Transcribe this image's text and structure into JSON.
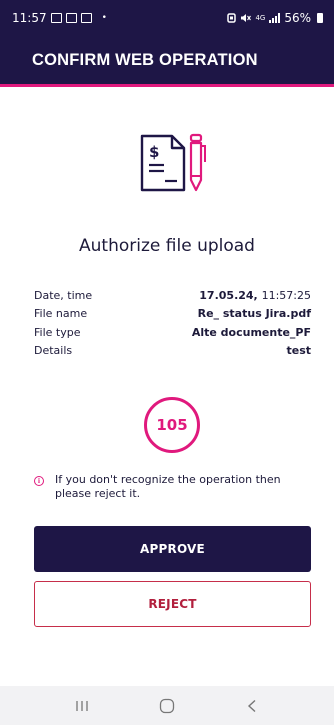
{
  "status_bar": {
    "time": "11:57",
    "dot": "•",
    "network_label": "4G",
    "battery_percent": "56%",
    "icons": [
      "gallery-icon",
      "gallery-icon",
      "gallery-icon",
      "battery-saver-icon",
      "mute-icon",
      "wifi-calling-icon",
      "signal-icon",
      "battery-icon"
    ]
  },
  "header": {
    "title": "CONFIRM WEB OPERATION"
  },
  "operation": {
    "icon": "invoice-pen-icon",
    "title": "Authorize file upload"
  },
  "details": {
    "date_label": "Date, time",
    "date_value": "17.05.24,",
    "time_value": "11:57:25",
    "file_name_label": "File name",
    "file_name_value": "Re_ status Jira.pdf",
    "file_type_label": "File type",
    "file_type_value": "Alte documente_PF",
    "details_label": "Details",
    "details_value": "test"
  },
  "timer": {
    "value": "105"
  },
  "notice": {
    "icon": "info-icon",
    "text": "If you don't recognize the operation then please reject it."
  },
  "actions": {
    "approve_label": "APPROVE",
    "reject_label": "REJECT"
  },
  "nav": {
    "items": [
      "recent-apps-icon",
      "home-icon",
      "back-icon"
    ]
  },
  "colors": {
    "primary": "#1e1646",
    "accent": "#e0197d",
    "reject": "#b21f3d"
  }
}
